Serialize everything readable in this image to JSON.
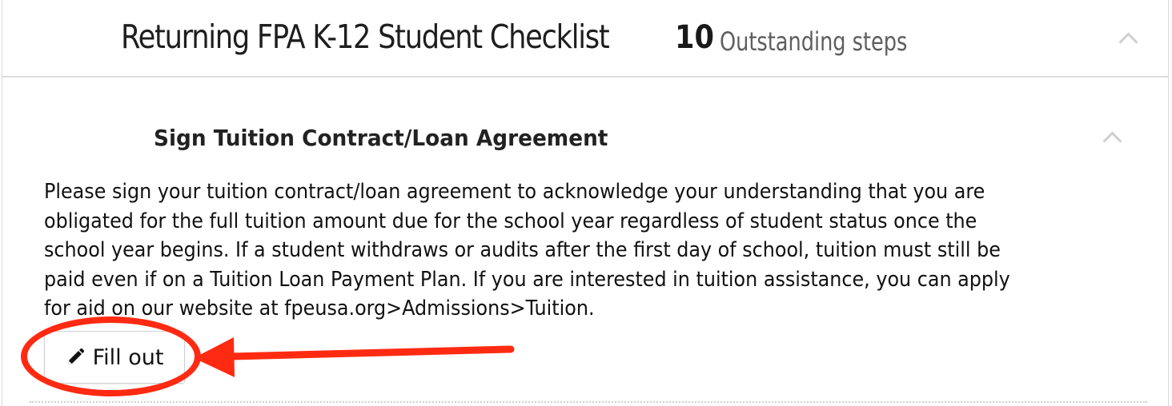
{
  "checklist": {
    "title": "Returning FPA K-12 Student Checklist",
    "outstanding_count": "10",
    "outstanding_label": "Outstanding steps",
    "collapse_icon": "chevron-up-icon"
  },
  "step": {
    "title": "Sign Tuition Contract/Loan Agreement",
    "description": "Please sign your tuition contract/loan agreement to acknowledge your understanding that you are obligated for the full tuition amount due for the school year regardless of student status once the school year begins. If a student withdraws or audits after the first day of school, tuition must still be paid even if on a Tuition Loan Payment Plan. If you are interested in tuition assistance, you can apply for aid on our website at fpeusa.org>Admissions>Tuition.",
    "button_label": "Fill out",
    "button_icon": "pencil-icon",
    "collapse_icon": "chevron-up-icon"
  },
  "annotation": {
    "color": "#ff2a12",
    "shapes": [
      "highlight-circle",
      "pointer-arrow"
    ]
  }
}
